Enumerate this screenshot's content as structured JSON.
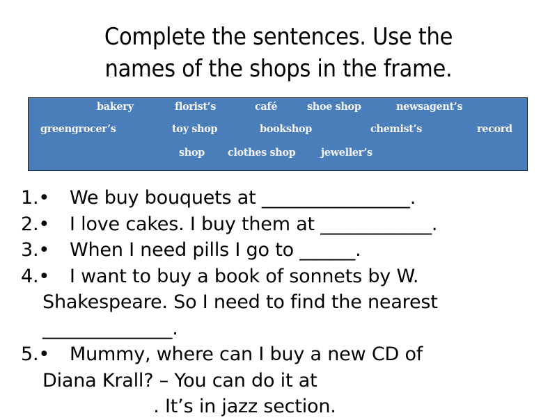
{
  "title": {
    "line1": "Complete the sentences. Use the",
    "line2": "names of the shops in the frame."
  },
  "frame": {
    "background_color": "#4a7ebb",
    "words": [
      "bakery",
      "florist’s",
      "café",
      "shoe shop",
      "newsagent’s",
      "greengrocer’s",
      "toy shop",
      "bookshop",
      "chemist’s",
      "record",
      "shop",
      "clothes shop",
      "jeweller’s"
    ]
  },
  "sentences": [
    {
      "number": "1.•",
      "lines": [
        "We buy bouquets at ________________."
      ]
    },
    {
      "number": "2.•",
      "lines": [
        "I love cakes. I buy them at ____________."
      ]
    },
    {
      "number": "3.•",
      "lines": [
        "When I need pills I go to ______."
      ]
    },
    {
      "number": "4.•",
      "lines": [
        "I want to buy a book of sonnets by W.",
        "Shakespeare. So I need to find the nearest",
        "______________."
      ]
    },
    {
      "number": "5.•",
      "lines": [
        "Mummy, where can I buy a new CD of",
        "Diana Krall? – You can do it at",
        "                   . It’s in jazz section."
      ]
    }
  ]
}
